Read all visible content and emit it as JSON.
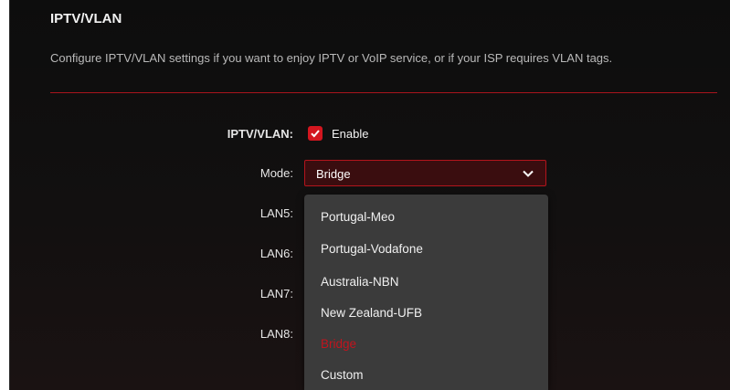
{
  "section": {
    "title": "IPTV/VLAN",
    "description": "Configure IPTV/VLAN settings if you want to enjoy IPTV or VoIP service, or if your ISP requires VLAN tags."
  },
  "form": {
    "iptv_label": "IPTV/VLAN:",
    "enable_label": "Enable",
    "enable_checked": true,
    "mode_label": "Mode:",
    "mode_value": "Bridge",
    "lan_labels": [
      "LAN5:",
      "LAN6:",
      "LAN7:",
      "LAN8:"
    ]
  },
  "dropdown": {
    "options": [
      "Portugal-Meo",
      "Portugal-Vodafone",
      "Australia-NBN",
      "New Zealand-UFB",
      "Bridge",
      "Custom"
    ],
    "selected": "Bridge"
  },
  "colors": {
    "accent": "#d3161f",
    "panel_bg": "#0d0d0d",
    "dropdown_bg": "#3b3b3b"
  },
  "icons": {
    "checkbox": "check-icon",
    "select": "chevron-down-icon"
  }
}
